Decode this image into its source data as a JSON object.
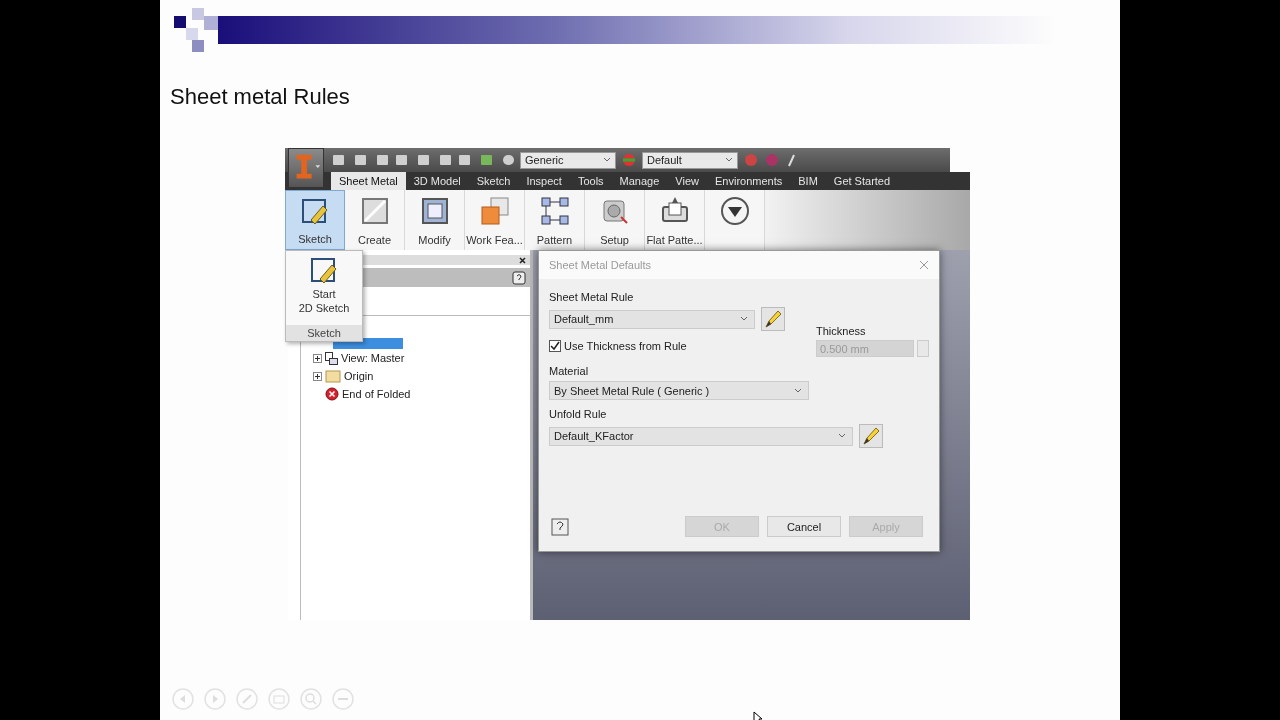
{
  "slide": {
    "title": "Sheet metal Rules"
  },
  "app": {
    "quick_access": {
      "style_dropdown": "Generic",
      "appearance_dropdown": "Default"
    },
    "tabs": [
      {
        "label": "Sheet Metal",
        "selected": true
      },
      {
        "label": "3D Model",
        "selected": false
      },
      {
        "label": "Sketch",
        "selected": false
      },
      {
        "label": "Inspect",
        "selected": false
      },
      {
        "label": "Tools",
        "selected": false
      },
      {
        "label": "Manage",
        "selected": false
      },
      {
        "label": "View",
        "selected": false
      },
      {
        "label": "Environments",
        "selected": false
      },
      {
        "label": "BIM",
        "selected": false
      },
      {
        "label": "Get Started",
        "selected": false
      }
    ],
    "ribbon_buttons": [
      {
        "label": "Sketch",
        "kind": "sketch",
        "selected": true
      },
      {
        "label": "Create",
        "kind": "create",
        "selected": false
      },
      {
        "label": "Modify",
        "kind": "modify",
        "selected": false
      },
      {
        "label": "Work Fea...",
        "kind": "work",
        "selected": false
      },
      {
        "label": "Pattern",
        "kind": "pattern",
        "selected": false
      },
      {
        "label": "Setup",
        "kind": "setup",
        "selected": false
      },
      {
        "label": "Flat Patte...",
        "kind": "flat",
        "selected": false
      },
      {
        "kind": "more",
        "selected": false
      }
    ],
    "sketch_menu": {
      "item_lines": [
        "Start",
        "2D Sketch"
      ],
      "panel": "Sketch"
    },
    "browser": {
      "root": {
        "selected": true,
        "children": [
          {
            "label": "View: Master",
            "kind": "view",
            "expanded": false
          },
          {
            "label": "Origin",
            "kind": "folder",
            "expanded": false
          },
          {
            "label": "End of Folded",
            "kind": "end"
          }
        ]
      }
    },
    "dialog": {
      "title": "Sheet Metal Defaults",
      "sheet_metal_rule": {
        "label": "Sheet Metal Rule",
        "value": "Default_mm"
      },
      "use_thickness": {
        "label": "Use Thickness from Rule",
        "checked": true
      },
      "thickness": {
        "label": "Thickness",
        "value": "0.500 mm",
        "disabled": true
      },
      "material": {
        "label": "Material",
        "value": "By Sheet Metal Rule ( Generic )"
      },
      "unfold_rule": {
        "label": "Unfold Rule",
        "value": "Default_KFactor"
      },
      "buttons": [
        {
          "label": "OK",
          "disabled": true
        },
        {
          "label": "Cancel",
          "disabled": false
        },
        {
          "label": "Apply",
          "disabled": true
        }
      ]
    }
  }
}
